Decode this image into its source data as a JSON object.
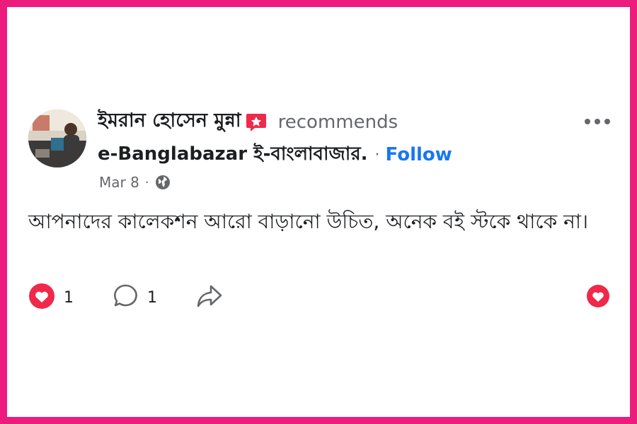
{
  "post": {
    "author": "ইমরান হোসেন মুন্না",
    "action_text": "recommends",
    "page_name": "e-Banglabazar ই-বাংলাবাজার.",
    "separator": "·",
    "follow_label": "Follow",
    "date": "Mar 8",
    "date_separator": "·",
    "text": "আপনাদের কালেকশন আরো বাড়ানো উচিত, অনেক বই স্টকে থাকে না।",
    "reactions_count": "1",
    "comments_count": "1"
  },
  "colors": {
    "frame": "#ec1b7d",
    "follow": "#1877f2",
    "muted": "#65676b",
    "heart": "#f0284a"
  },
  "icons": {
    "badge": "recommend-badge-icon",
    "globe": "globe-icon",
    "more": "more-options-icon",
    "love": "love-reaction-icon",
    "comment": "comment-icon",
    "share": "share-icon"
  }
}
